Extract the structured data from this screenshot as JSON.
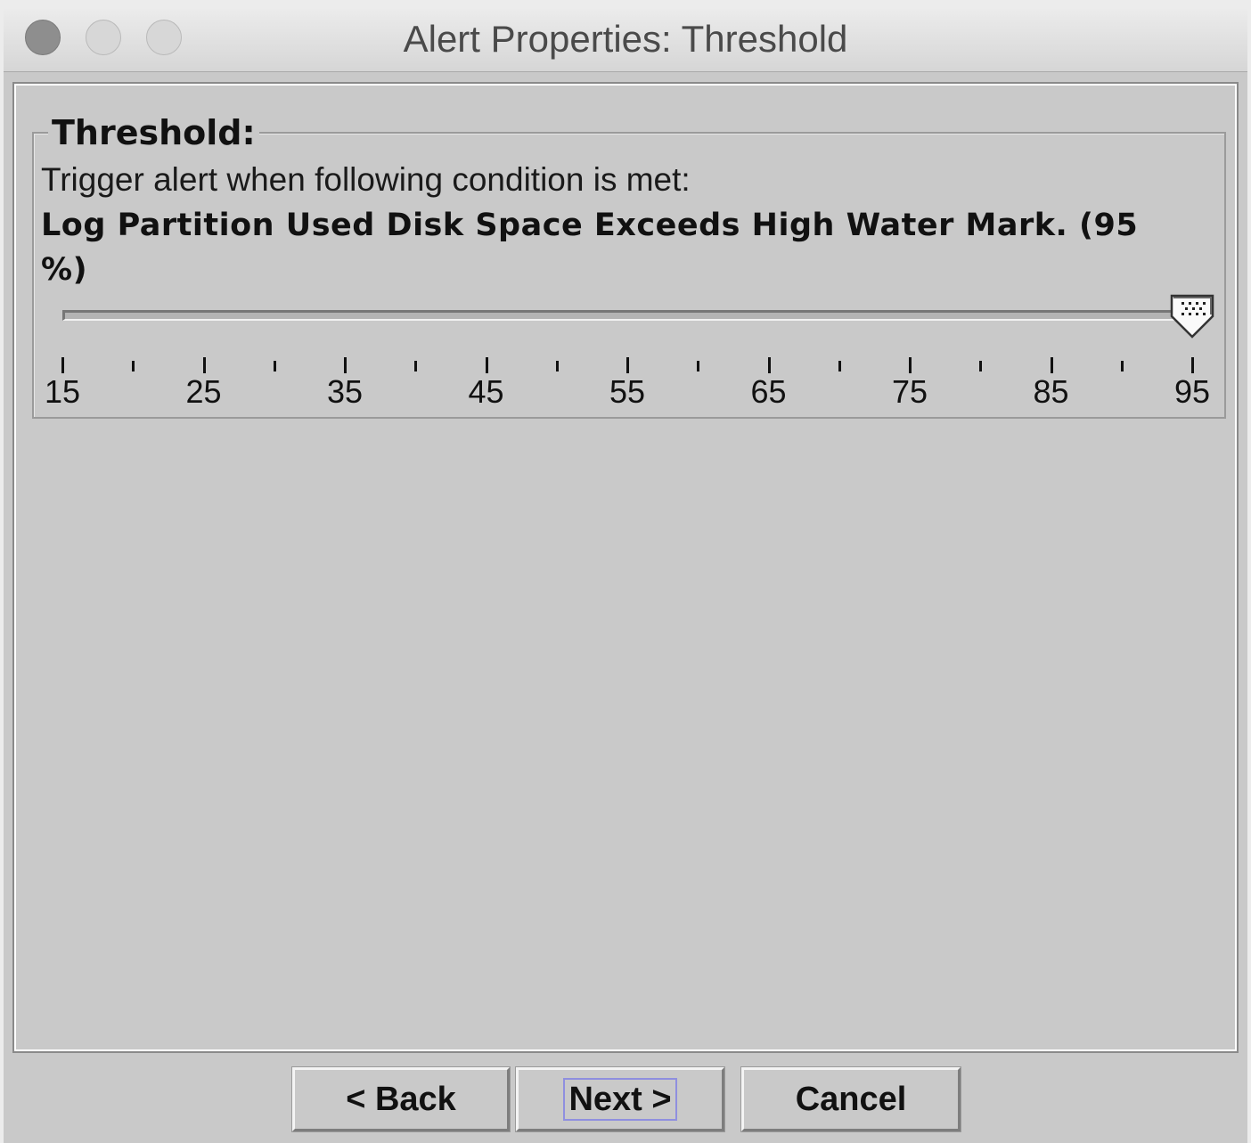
{
  "window": {
    "title": "Alert Properties: Threshold"
  },
  "threshold": {
    "legend": "Threshold:",
    "prompt": "Trigger alert when following condition is met:",
    "condition_line1": "Log Partition Used Disk Space Exceeds High Water Mark. (95",
    "condition_line2": "%)"
  },
  "slider": {
    "min": 15,
    "max": 95,
    "value": 95,
    "major_tick_spacing": 10,
    "minor_tick_spacing": 5,
    "labels": [
      "15",
      "25",
      "35",
      "45",
      "55",
      "65",
      "75",
      "85",
      "95"
    ]
  },
  "buttons": {
    "back": "< Back",
    "next": "Next >",
    "cancel": "Cancel"
  },
  "icons": {
    "close": "close-icon",
    "minimize": "minimize-icon",
    "zoom": "zoom-icon",
    "slider_thumb": "slider-thumb-icon"
  },
  "colors": {
    "background": "#c9c9c9",
    "focus_ring": "#8f8fdf"
  }
}
